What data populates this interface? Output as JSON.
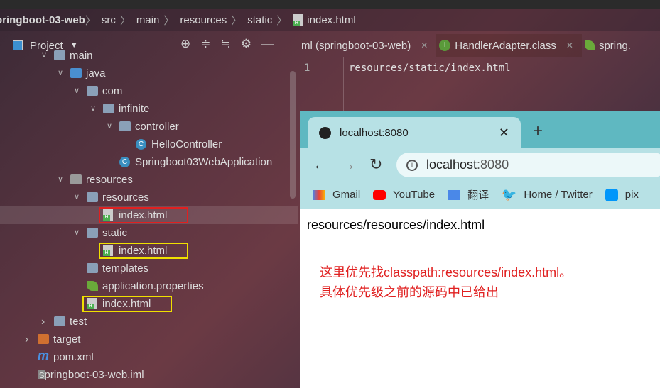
{
  "breadcrumb": [
    "pringboot-03-web",
    "src",
    "main",
    "resources",
    "static",
    "index.html"
  ],
  "project_panel": {
    "title": "Project"
  },
  "editor_tabs": [
    {
      "label": "ml (springboot-03-web)"
    },
    {
      "label": "HandlerAdapter.class"
    },
    {
      "label": "spring."
    }
  ],
  "editor": {
    "line_number": "1",
    "code": "resources/static/index.html"
  },
  "tree": [
    {
      "label": "main",
      "level": 2,
      "type": "folder",
      "expanded": true
    },
    {
      "label": "java",
      "level": 3,
      "type": "folder-blue",
      "expanded": true
    },
    {
      "label": "com",
      "level": 4,
      "type": "package",
      "expanded": true
    },
    {
      "label": "infinite",
      "level": 5,
      "type": "package",
      "expanded": true
    },
    {
      "label": "controller",
      "level": 6,
      "type": "package",
      "expanded": true
    },
    {
      "label": "HelloController",
      "level": 7,
      "type": "class"
    },
    {
      "label": "Springboot03WebApplication",
      "level": 6,
      "type": "class"
    },
    {
      "label": "resources",
      "level": 3,
      "type": "folder-res",
      "expanded": true
    },
    {
      "label": "resources",
      "level": 4,
      "type": "folder",
      "expanded": true
    },
    {
      "label": "index.html",
      "level": 5,
      "type": "html",
      "selected": true,
      "highlight": "#e02020"
    },
    {
      "label": "static",
      "level": 4,
      "type": "folder",
      "expanded": true
    },
    {
      "label": "index.html",
      "level": 5,
      "type": "html",
      "highlight": "#f0e000"
    },
    {
      "label": "templates",
      "level": 4,
      "type": "folder"
    },
    {
      "label": "application.properties",
      "level": 4,
      "type": "spring"
    },
    {
      "label": "index.html",
      "level": 4,
      "type": "html",
      "highlight": "#f0e000"
    },
    {
      "label": "test",
      "level": 2,
      "type": "folder",
      "expanded": false
    },
    {
      "label": "target",
      "level": 1,
      "type": "folder-orange",
      "expanded": false
    },
    {
      "label": "pom.xml",
      "level": 1,
      "type": "maven"
    },
    {
      "label": "springboot-03-web.iml",
      "level": 1,
      "type": "iml"
    }
  ],
  "browser": {
    "tab_title": "localhost:8080",
    "url_host": "localhost",
    "url_port": ":8080",
    "bookmarks": [
      "Gmail",
      "YouTube",
      "翻译",
      "Home / Twitter",
      "pix"
    ],
    "page_text": "resources/resources/index.html",
    "annotation": [
      "这里优先找classpath:resources/index.html。",
      "具体优先级之前的源码中已给出"
    ]
  }
}
